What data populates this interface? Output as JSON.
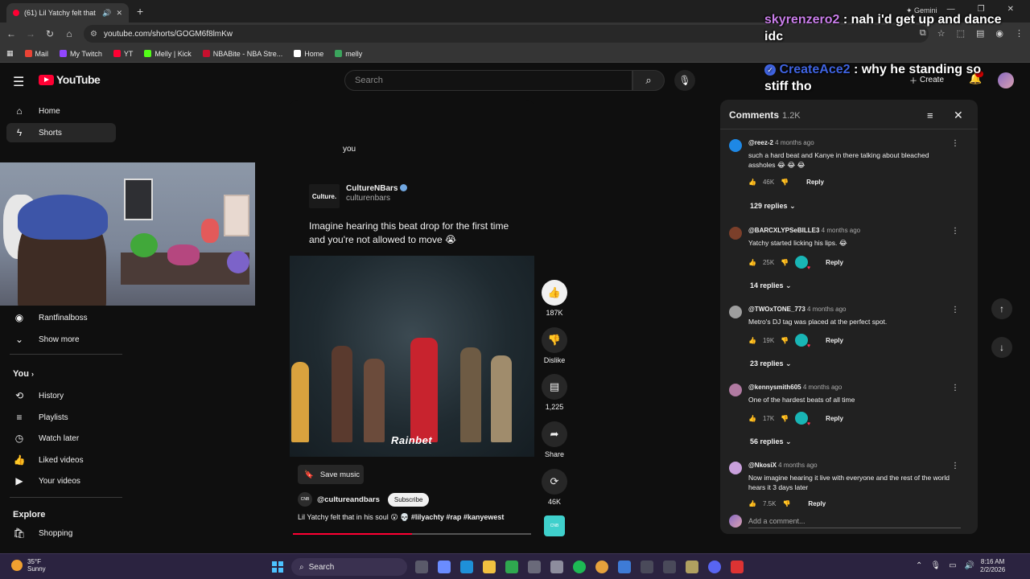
{
  "browser": {
    "tab_title": "(61) Lil Yatchy felt that in hi",
    "url": "youtube.com/shorts/GOGM6f8lmKw",
    "gemini": "Gemini",
    "bookmarks": [
      {
        "label": "Mail",
        "color": "#ea4335"
      },
      {
        "label": "My Twitch",
        "color": "#9146ff"
      },
      {
        "label": "YT",
        "color": "#ff0033"
      },
      {
        "label": "Melly | Kick",
        "color": "#53fc18"
      },
      {
        "label": "NBABite - NBA Stre...",
        "color": "#c8102e"
      },
      {
        "label": "Home",
        "color": "#ffffff"
      },
      {
        "label": "melly",
        "color": "#3ba55d"
      }
    ]
  },
  "header": {
    "logo_text": "YouTube",
    "search_placeholder": "Search",
    "create_label": "Create"
  },
  "sidebar": {
    "home": "Home",
    "shorts": "Shorts",
    "subscription": "Rantfinalboss",
    "show_more": "Show more",
    "you_heading": "You",
    "you_items": [
      "History",
      "Playlists",
      "Watch later",
      "Liked videos",
      "Your videos"
    ],
    "explore_heading": "Explore",
    "explore_items": [
      "Shopping"
    ]
  },
  "short": {
    "caption_top": "you",
    "post_channel": "CultureNBars",
    "post_logo": "Culture.",
    "post_handle": "culturenbars",
    "post_text": "Imagine hearing this beat drop for the first time and you're not allowed to move 😭",
    "watermark": "Rainbet",
    "save_music": "Save music",
    "channel_handle": "@cultureandbars",
    "channel_avatar": "CNB",
    "subscribe": "Subscribe",
    "caption_text": "Lil Yatchy felt that in his soul 😮 💀 ",
    "caption_tags": "#lilyachty #rap #kanyewest",
    "progress": 0.5
  },
  "actions": {
    "likes": "187K",
    "dislike": "Dislike",
    "comments": "1,225",
    "share": "Share",
    "remix": "46K"
  },
  "comments": {
    "title": "Comments",
    "count": "1.2K",
    "add_placeholder": "Add a comment...",
    "items": [
      {
        "user": "@reez-2",
        "ago": "4 months ago",
        "text": "such a hard beat and Kanye in there talking about bleached assholes 😂 😂 😂",
        "likes": "46K",
        "replies": "129 replies",
        "avatar_color": "#1e88e5",
        "reply": "Reply"
      },
      {
        "user": "@BARCXLYPSeBILLE3",
        "ago": "4 months ago",
        "text": "Yatchy started licking his lips. 😂",
        "likes": "25K",
        "replies": "14 replies",
        "avatar_color": "#7b3f2a",
        "reply": "Reply"
      },
      {
        "user": "@TWOxTONE_773",
        "ago": "4 months ago",
        "text": "Metro's DJ tag was placed at the perfect spot.",
        "likes": "19K",
        "replies": "23 replies",
        "avatar_color": "#9e9e9e",
        "reply": "Reply"
      },
      {
        "user": "@kennysmith605",
        "ago": "4 months ago",
        "text": "One of the hardest beats of all time",
        "likes": "17K",
        "replies": "56 replies",
        "avatar_color": "#b07aa1",
        "reply": "Reply"
      },
      {
        "user": "@NkosiX",
        "ago": "4 months ago",
        "text": "Now imagine hearing it live with everyone and the rest of the world hears it 3 days later",
        "likes": "7.5K",
        "replies": "",
        "avatar_color": "#c9a0dc",
        "reply": "Reply"
      }
    ]
  },
  "chat": {
    "user1": "skyrenzero2",
    "msg1": " : nah i'd get up and dance idc",
    "user2": "CreateAce2",
    "msg2": " : why he standing so stiff tho"
  },
  "taskbar": {
    "temp": "35°F",
    "condition": "Sunny",
    "search": "Search",
    "time": "8:16 AM",
    "date": "2/2/2026"
  }
}
